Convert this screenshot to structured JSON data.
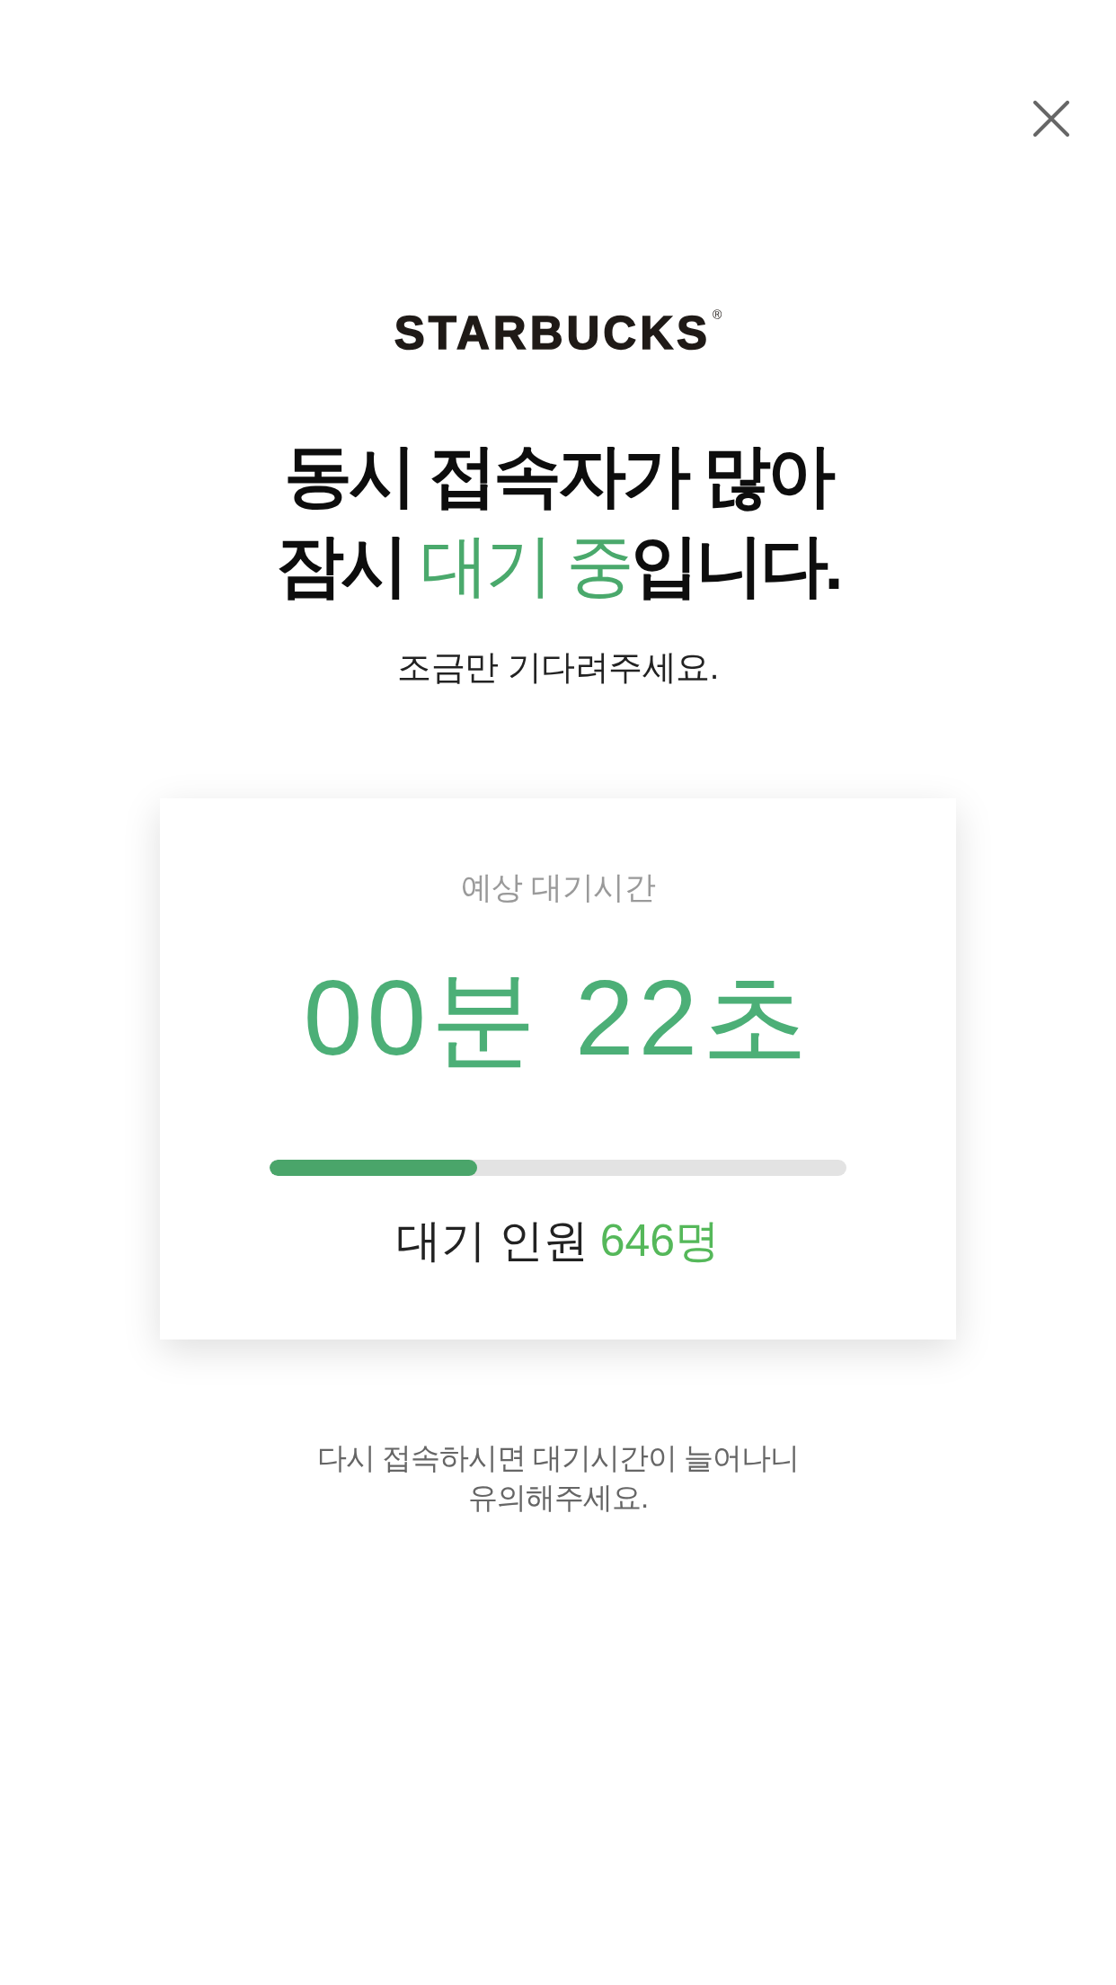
{
  "logo": "STARBUCKS$^{®}$",
  "title": {
    "lines": [
      [
        {
          "text": "동시 접속자가 많아",
          "highlight": false
        }
      ],
      [
        {
          "text": "잠시 ",
          "highlight": false
        },
        {
          "text": "대기 중",
          "highlight": true
        },
        {
          "text": "입니다.",
          "highlight": false
        }
      ]
    ]
  },
  "subtitle": "조금만 기다려주세요.",
  "wait_card": {
    "label": "예상 대기시간",
    "time": "00분 22초",
    "progress": {
      "level": 0.36
    },
    "queue": {
      "label": "대기 인원",
      "count": "646명"
    }
  },
  "notice": "다시 접속하시면 대기시간이 늘어나니\n유의해주세요."
}
